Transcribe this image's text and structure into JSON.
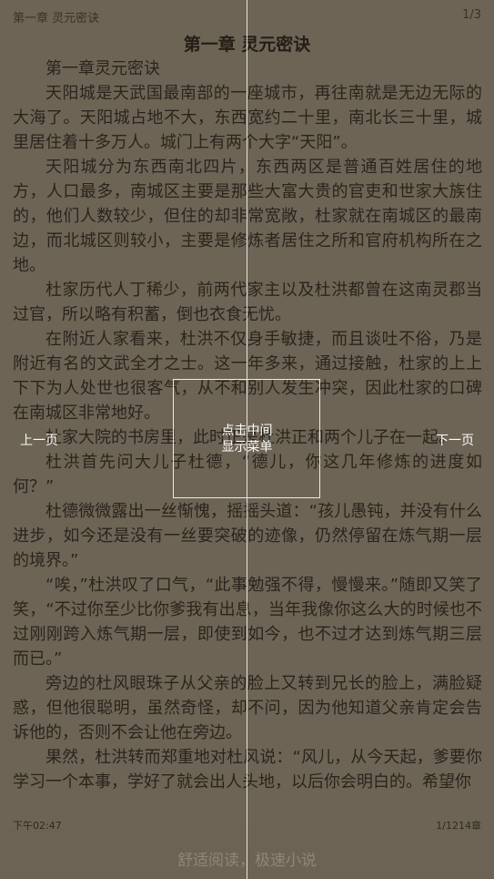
{
  "header": {
    "chapter": "第一章 灵元密诀",
    "page_indicator": "1/3"
  },
  "reader": {
    "title": "第一章 灵元密诀",
    "paragraphs": [
      "第一章灵元密诀",
      "天阳城是天武国最南部的一座城市，再往南就是无边无际的大海了。天阳城占地不大，东西宽约二十里，南北长三十里，城里居住着十多万人。城门上有两个大字“天阳”。",
      "天阳城分为东西南北四片，东西两区是普通百姓居住的地方，人口最多，南城区主要是那些大富大贵的官吏和世家大族住的，他们人数较少，但住的却非常宽敞，杜家就在南城区的最南边，而北城区则较小，主要是修炼者居住之所和官府机构所在之地。",
      "杜家历代人丁稀少，前两代家主以及杜洪都曾在这南灵郡当过官，所以略有积蓄，倒也衣食无忧。",
      "在附近人家看来，杜洪不仅身手敏捷，而且谈吐不俗，乃是附近有名的文武全才之士。这一年多来，通过接触，杜家的上上下下为人处世也很客气，从不和别人发生冲突，因此杜家的口碑在南城区非常地好。",
      "杜家大院的书房里，此时正是杜洪正和两个儿子在一起。",
      "杜洪首先问大儿子杜德，“德儿，你这几年修炼的进度如何？”",
      "杜德微微露出一丝惭愧，摇摇头道：“孩儿愚钝，并没有什么进步，如今还是没有一丝要突破的迹像，仍然停留在炼气期一层的境界。”",
      "“唉，”杜洪叹了口气，“此事勉强不得，慢慢来。”随即又笑了笑，“不过你至少比你爹我有出息，当年我像你这么大的时候也不过刚刚跨入炼气期一层，即使到如今，也不过才达到炼气期三层而已。”",
      "旁边的杜风眼珠子从父亲的脸上又转到兄长的脸上，满脸疑惑，但他很聪明，虽然奇怪，却不问，因为他知道父亲肯定会告诉他的，否则不会让他在旁边。",
      "果然，杜洪转而郑重地对杜风说：“风儿，从今天起，爹要你学习一个本事，学好了就会出人头地，以后你会明白的。希望你"
    ]
  },
  "overlay": {
    "prev_label": "上一页",
    "next_label": "下一页",
    "center_line1": "点击中间",
    "center_line2": "显示菜单"
  },
  "footer": {
    "time": "下午02:47",
    "progress": "1/1214章"
  },
  "banner": {
    "text": "舒适阅读，极速小说"
  }
}
